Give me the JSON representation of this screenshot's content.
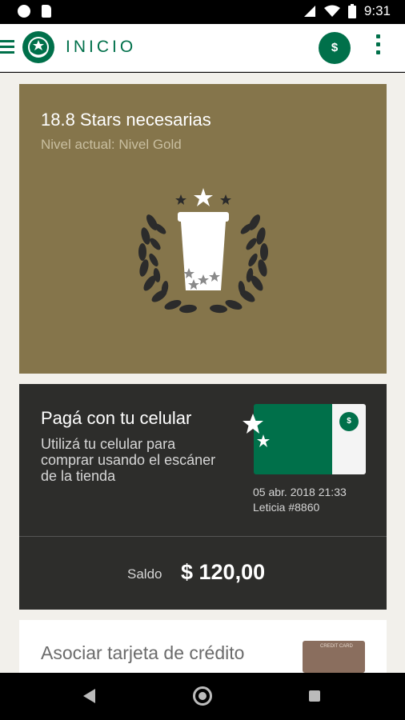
{
  "status_bar": {
    "time": "9:31"
  },
  "app_bar": {
    "title": "INICIO",
    "currency_symbol": "$"
  },
  "gold_card": {
    "title": "18.8 Stars necesarias",
    "subtitle": "Nivel actual: Nivel Gold"
  },
  "pay_card": {
    "title": "Pagá con tu celular",
    "description": "Utilizá tu celular para comprar usando el escáner de la tienda",
    "card_badge": "$",
    "date": "05 abr. 2018 21:33",
    "owner": "Leticia #8860",
    "balance_label": "Saldo",
    "balance_value": "$ 120,00"
  },
  "credit_card": {
    "title": "Asociar tarjeta de crédito",
    "card_image_text": "CREDIT CARD"
  },
  "colors": {
    "brand_green": "#00704a",
    "gold": "#85754b",
    "dark_card": "#2d2d2b"
  }
}
